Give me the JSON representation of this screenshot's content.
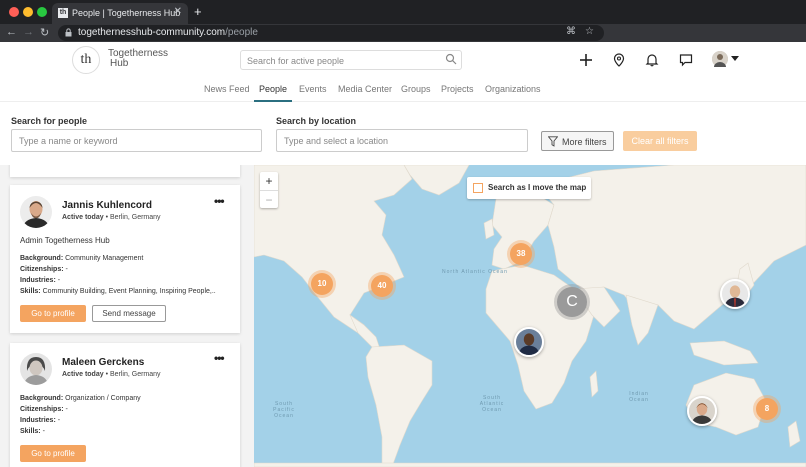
{
  "browser": {
    "tab_title": "People | Togetherness Hub",
    "tab_favicon_text": "th",
    "url_host": "togethernesshub-community.com",
    "url_path": "/people"
  },
  "header": {
    "logo_mark": "th",
    "logo_line1": "Togetherness",
    "logo_line2": "Hub",
    "search_placeholder": "Search for active people"
  },
  "nav": {
    "items": [
      {
        "label": "News Feed"
      },
      {
        "label": "People"
      },
      {
        "label": "Events"
      },
      {
        "label": "Media Center"
      },
      {
        "label": "Groups"
      },
      {
        "label": "Projects"
      },
      {
        "label": "Organizations"
      }
    ],
    "active": "People"
  },
  "filters": {
    "people_label": "Search for people",
    "people_placeholder": "Type a name or keyword",
    "location_label": "Search by location",
    "location_placeholder": "Type and select a location",
    "more_filters": "More filters",
    "clear_filters": "Clear all filters"
  },
  "people": [
    {
      "name": "Jannis Kuhlencord",
      "status": "Active today",
      "location": "Berlin, Germany",
      "role": "Admin Togetherness Hub",
      "background_label": "Background:",
      "background": "Community Management",
      "citizenships_label": "Citizenships:",
      "citizenships": "-",
      "industries_label": "Industries:",
      "industries": "-",
      "skills_label": "Skills:",
      "skills": "Community Building, Event Planning, Inspiring People,..",
      "profile_button": "Go to profile",
      "message_button": "Send message"
    },
    {
      "name": "Maleen Gerckens",
      "status": "Active today",
      "location": "Berlin, Germany",
      "background_label": "Background:",
      "background": "Organization / Company",
      "citizenships_label": "Citizenships:",
      "citizenships": "-",
      "industries_label": "Industries:",
      "industries": "-",
      "skills_label": "Skills:",
      "skills": "-",
      "profile_button": "Go to profile"
    }
  ],
  "map": {
    "move_toggle_label": "Search as I move the map",
    "zoom_in": "+",
    "zoom_out": "−",
    "clusters": [
      {
        "count": "10"
      },
      {
        "count": "40"
      },
      {
        "count": "38"
      },
      {
        "count": "8"
      }
    ],
    "gray_cluster_label": "C",
    "ocean_labels": {
      "north_atlantic": "North Atlantic Ocean",
      "south_pacific": "South Pacific Ocean",
      "south_atlantic": "South Atlantic Ocean",
      "indian": "Indian Ocean"
    },
    "accent_color": "#f4a460"
  },
  "colors": {
    "brand_teal": "#2b6f80",
    "accent_orange": "#f4a460",
    "water": "#a3d1e8",
    "land": "#f4f1ea"
  }
}
